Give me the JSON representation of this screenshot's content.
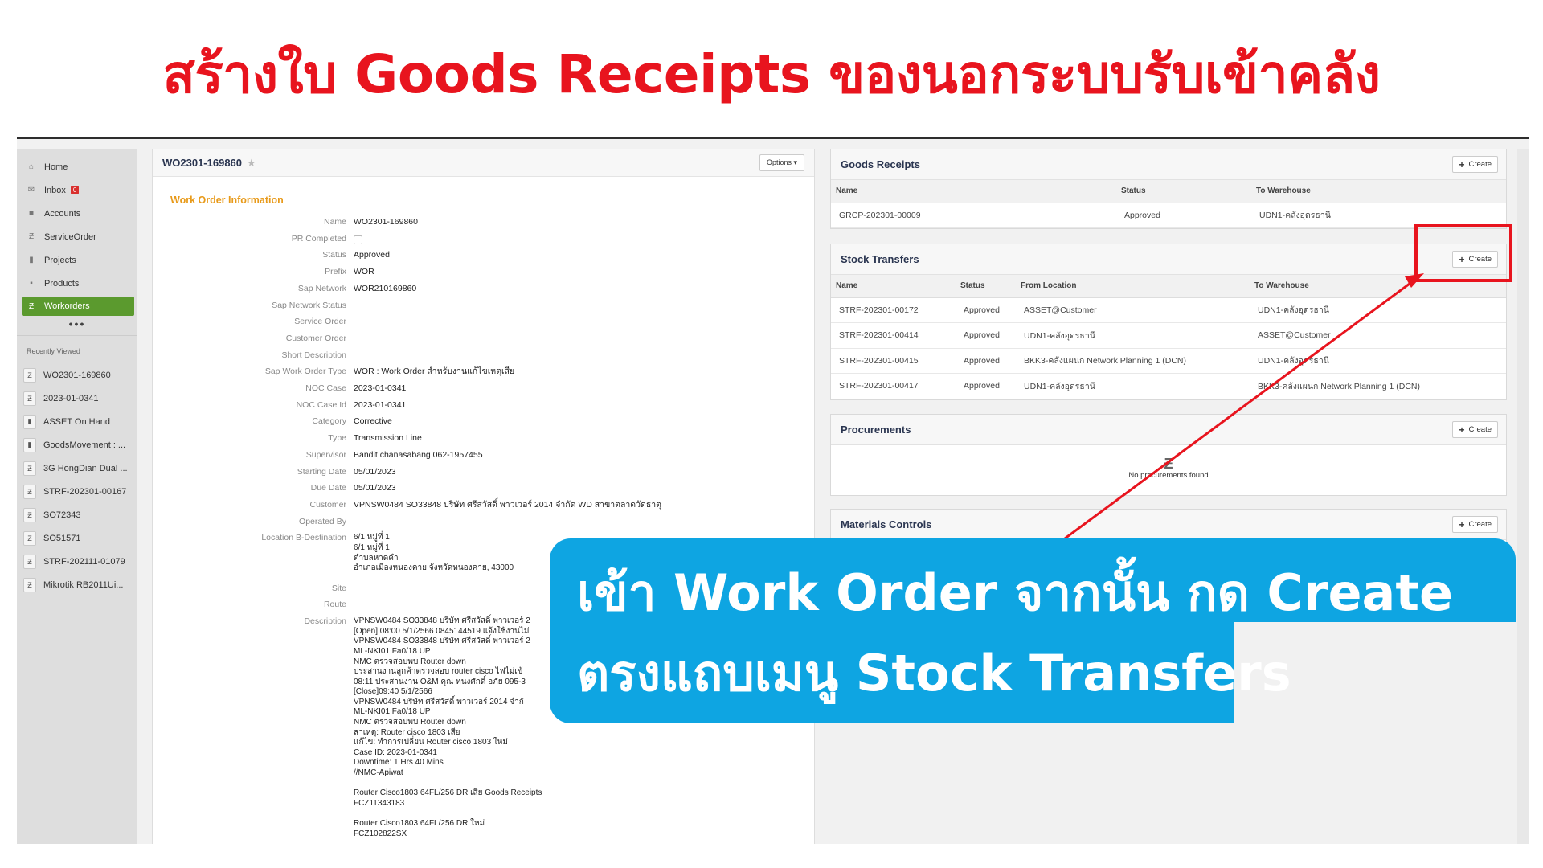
{
  "headline": "สร้างใบ Goods Receipts ของนอกระบบรับเข้าคลัง",
  "sidebar": {
    "items": [
      {
        "label": "Home",
        "icon": "home-icon"
      },
      {
        "label": "Inbox",
        "icon": "mail-icon",
        "badge": "0"
      },
      {
        "label": "Accounts",
        "icon": "folder-icon"
      },
      {
        "label": "ServiceOrder",
        "icon": "z-icon"
      },
      {
        "label": "Projects",
        "icon": "chart-icon"
      },
      {
        "label": "Products",
        "icon": "box-icon"
      },
      {
        "label": "Workorders",
        "icon": "z-icon"
      }
    ],
    "more": "•••",
    "recent_title": "Recently Viewed",
    "recent": [
      "WO2301-169860",
      "2023-01-0341",
      "ASSET On Hand",
      "GoodsMovement : ...",
      "3G HongDian Dual ...",
      "STRF-202301-00167",
      "SO72343",
      "SO51571",
      "STRF-202111-01079",
      "Mikrotik RB2011Ui..."
    ]
  },
  "workorder": {
    "title": "WO2301-169860",
    "options_label": "Options ▾",
    "section_title": "Work Order Information",
    "fields": [
      {
        "label": "Name",
        "value": "WO2301-169860"
      },
      {
        "label": "PR Completed",
        "value": ""
      },
      {
        "label": "Status",
        "value": "Approved"
      },
      {
        "label": "Prefix",
        "value": "WOR"
      },
      {
        "label": "Sap Network",
        "value": "WOR210169860"
      },
      {
        "label": "Sap Network Status",
        "value": ""
      },
      {
        "label": "Service Order",
        "value": ""
      },
      {
        "label": "Customer Order",
        "value": ""
      },
      {
        "label": "Short Description",
        "value": ""
      },
      {
        "label": "Sap Work Order Type",
        "value": "WOR : Work Order สำหรับงานแก้ไขเหตุเสีย"
      },
      {
        "label": "NOC Case",
        "value": "2023-01-0341"
      },
      {
        "label": "NOC Case Id",
        "value": "2023-01-0341"
      },
      {
        "label": "Category",
        "value": "Corrective"
      },
      {
        "label": "Type",
        "value": "Transmission Line"
      },
      {
        "label": "Supervisor",
        "value": "Bandit chanasabang 062-1957455"
      },
      {
        "label": "Starting Date",
        "value": "05/01/2023"
      },
      {
        "label": "Due Date",
        "value": "05/01/2023"
      },
      {
        "label": "Customer",
        "value": "VPNSW0484 SO33848 บริษัท ศรีสวัสดิ์ พาวเวอร์ 2014 จำกัด WD สาขาตลาดวัดธาตุ"
      },
      {
        "label": "Operated By",
        "value": ""
      }
    ],
    "location_label": "Location B-Destination",
    "location_value": "6/1 หมู่ที่ 1\n6/1 หมู่ที่ 1\nตำบลหาดคำ\nอำเภอเมืองหนองคาย จังหวัดหนองคาย, 43000",
    "site_label": "Site",
    "route_label": "Route",
    "description_label": "Description",
    "description_value": "VPNSW0484 SO33848 บริษัท ศรีสวัสดิ์ พาวเวอร์ 2\n[Open] 08:00 5/1/2566 0845144519 แจ้งใช้งานไม่\nVPNSW0484 SO33848 บริษัท ศรีสวัสดิ์ พาวเวอร์ 2\nML-NKI01 Fa0/18 UP\nNMC ตรวจสอบพบ Router down\nประสานงานลูกค้าตรวจสอบ router cisco ไฟไม่เข้\n08:11 ประสานงาน O&M คุณ ทนงศักดิ์ อภัย 095-3\n[Close]09:40 5/1/2566\nVPNSW0484 บริษัท ศรีสวัสดิ์ พาวเวอร์ 2014 จำกั\nML-NKI01 Fa0/18 UP\nNMC ตรวจสอบพบ Router down\nสาเหตุ: Router cisco 1803 เสีย\nแก้ไข: ทำการเปลี่ยน Router cisco 1803 ใหม่\nCase ID: 2023-01-0341\nDowntime: 1 Hrs 40 Mins\n//NMC-Apiwat\n\nRouter Cisco1803 64FL/256 DR เสีย Goods Receipts\nFCZ11343183\n\nRouter Cisco1803 64FL/256 DR ใหม่\nFCZ102822SX"
  },
  "goods_receipts": {
    "title": "Goods Receipts",
    "create_label": "Create",
    "columns": [
      "Name",
      "Status",
      "To Warehouse"
    ],
    "rows": [
      [
        "GRCP-202301-00009",
        "Approved",
        "UDN1-คลังอุดรธานี"
      ]
    ]
  },
  "stock_transfers": {
    "title": "Stock Transfers",
    "create_label": "Create",
    "columns": [
      "Name",
      "Status",
      "From Location",
      "To Warehouse"
    ],
    "rows": [
      [
        "STRF-202301-00172",
        "Approved",
        "ASSET@Customer",
        "UDN1-คลังอุดรธานี"
      ],
      [
        "STRF-202301-00414",
        "Approved",
        "UDN1-คลังอุดรธานี",
        "ASSET@Customer"
      ],
      [
        "STRF-202301-00415",
        "Approved",
        "BKK3-คลังแผนก Network Planning 1 (DCN)",
        "UDN1-คลังอุดรธานี"
      ],
      [
        "STRF-202301-00417",
        "Approved",
        "UDN1-คลังอุดรธานี",
        "BKK3-คลังแผนก Network Planning 1 (DCN)"
      ]
    ]
  },
  "procurements": {
    "title": "Procurements",
    "create_label": "Create",
    "empty_text": "No procurements found"
  },
  "materials_controls": {
    "title": "Materials Controls",
    "create_label": "Create"
  },
  "callout": {
    "line1": "เข้า Work Order จากนั้น กด Create",
    "line2": "ตรงแถบเมนู Stock Transfers"
  },
  "colors": {
    "headline": "#e8141e",
    "callout_bg": "#0ea5e2",
    "active_nav": "#5b9a2e",
    "section_title": "#e89a1a"
  }
}
